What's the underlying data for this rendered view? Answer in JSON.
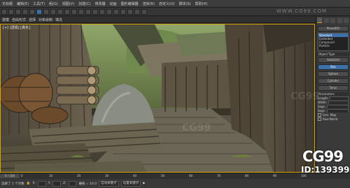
{
  "menubar": {
    "items": [
      "无标题",
      "编辑(E)",
      "工具(T)",
      "组(G)",
      "视图(V)",
      "创建(C)",
      "修改器",
      "动画",
      "图形编辑器",
      "渲染(R)",
      "自定义(U)",
      "脚本(S)",
      "帮助(H)"
    ]
  },
  "ribbon": {
    "items": [
      "建模",
      "自由形式",
      "选择",
      "对象绘制",
      "填充"
    ]
  },
  "viewport": {
    "label": "[+] [透视] [真实]"
  },
  "panel": {
    "object_name": "Plane001",
    "buttons": [
      "Object Type",
      "AutoGrid",
      "Box",
      "Sphere",
      "Cylinder",
      "Torus"
    ],
    "list": [
      "Standard",
      "Extended",
      "Compound",
      "Particle"
    ],
    "section_params": "Parameters",
    "rows": [
      "Length:",
      "Width:",
      "Segs:",
      "Segs:",
      "Gen. Map",
      "Real-World"
    ]
  },
  "timeline": {
    "frame_label": "0 / 100",
    "ticks": [
      "0",
      "10",
      "20",
      "30",
      "40",
      "50",
      "60",
      "70",
      "80",
      "90",
      "100"
    ]
  },
  "statusbar": {
    "selection": "选择了 1 个对象",
    "x_label": "X:",
    "y_label": "Y:",
    "z_label": "Z:",
    "grid": "栅格 = 10.0",
    "autokey": "自动关键点",
    "setkey": "设置关键点"
  },
  "watermark": {
    "logo": "CG99",
    "id": "ID:139399",
    "url": "WWW.CG99.COM",
    "faint": "CG99"
  },
  "colors": {
    "selection_border": "#d9a400",
    "accent_blue": "#3d6fa8"
  }
}
